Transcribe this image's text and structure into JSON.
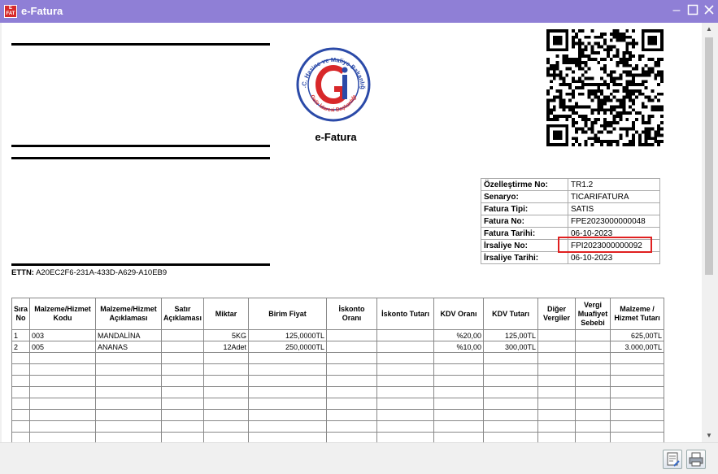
{
  "window": {
    "title": "e-Fatura",
    "app_icon_text": "E FAT"
  },
  "document": {
    "title": "e-Fatura",
    "logo_text": {
      "top": "T.C. Hazine ve Maliye Bakanlığı",
      "bottom": "Gelir İdaresi Başkanlığı"
    },
    "ettn_label": "ETTN:",
    "ettn_value": "A20EC2F6-231A-433D-A629-A10EB9"
  },
  "info": [
    {
      "label": "Özelleştirme No:",
      "value": "TR1.2"
    },
    {
      "label": "Senaryo:",
      "value": "TICARIFATURA"
    },
    {
      "label": "Fatura Tipi:",
      "value": "SATIS"
    },
    {
      "label": "Fatura No:",
      "value": "FPE2023000000048"
    },
    {
      "label": "Fatura Tarihi:",
      "value": "06-10-2023"
    },
    {
      "label": "İrsaliye No:",
      "value": "FPI2023000000092"
    },
    {
      "label": "İrsaliye Tarihi:",
      "value": "06-10-2023"
    }
  ],
  "items_table": {
    "headers": [
      "Sıra No",
      "Malzeme/Hizmet Kodu",
      "Malzeme/Hizmet Açıklaması",
      "Satır Açıklaması",
      "Miktar",
      "Birim Fiyat",
      "İskonto Oranı",
      "İskonto Tutarı",
      "KDV Oranı",
      "KDV Tutarı",
      "Diğer Vergiler",
      "Vergi Muafiyet Sebebi",
      "Malzeme / Hizmet Tutarı"
    ],
    "rows": [
      [
        "1",
        "003",
        "MANDALİNA",
        "",
        "5KG",
        "125,0000TL",
        "",
        "",
        "%20,00",
        "125,00TL",
        "",
        "",
        "625,00TL"
      ],
      [
        "2",
        "005",
        "ANANAS",
        "",
        "12Adet",
        "250,0000TL",
        "",
        "",
        "%10,00",
        "300,00TL",
        "",
        "",
        "3.000,00TL"
      ]
    ]
  }
}
